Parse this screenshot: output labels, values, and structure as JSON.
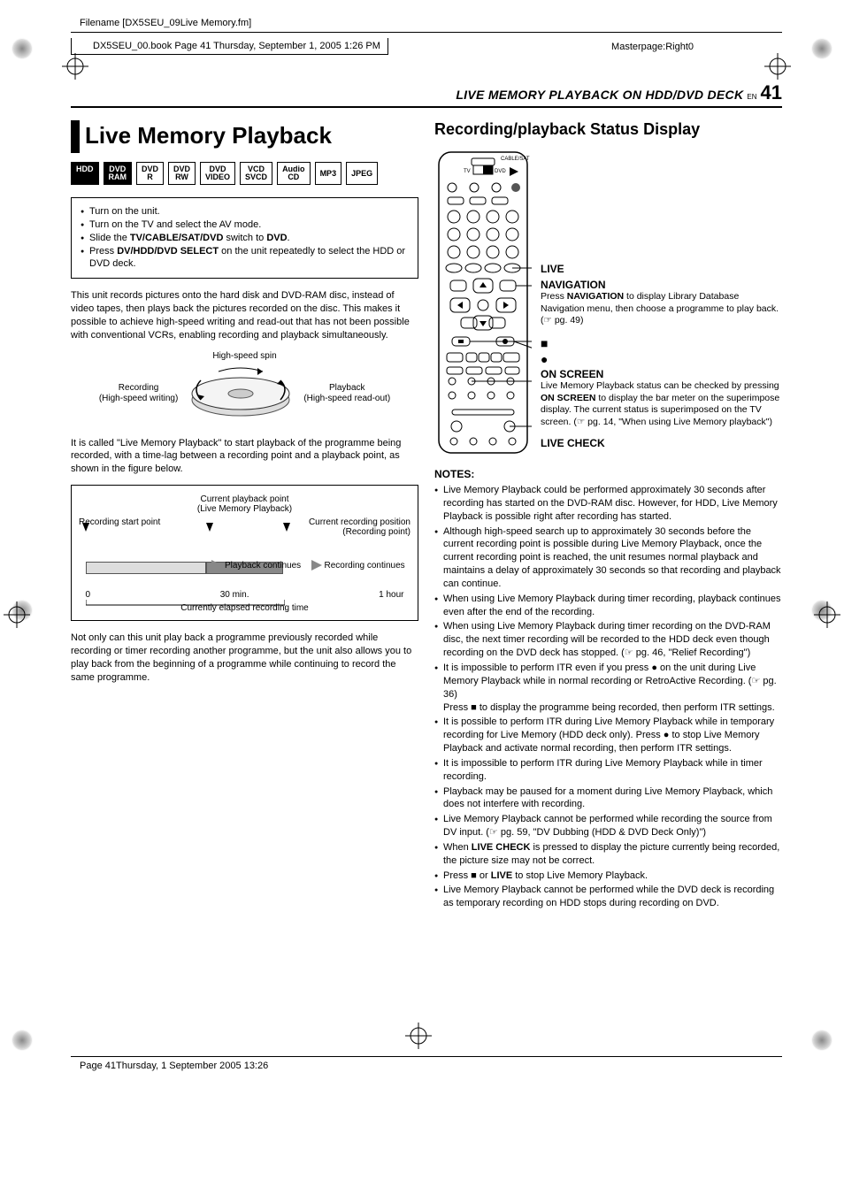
{
  "meta": {
    "filename": "Filename [DX5SEU_09Live Memory.fm]",
    "book_line": "DX5SEU_00.book  Page 41  Thursday, September 1, 2005  1:26 PM",
    "masterpage": "Masterpage:Right0",
    "footer": "Page 41Thursday, 1 September 2005  13:26"
  },
  "header": {
    "title": "LIVE MEMORY PLAYBACK ON HDD/DVD DECK",
    "lang": "EN",
    "page": "41"
  },
  "left": {
    "title": "Live Memory Playback",
    "badges_solid": [
      "HDD"
    ],
    "badges_two": [
      {
        "top": "DVD",
        "bottom": "RAM"
      }
    ],
    "badges_outline_two": [
      {
        "top": "DVD",
        "bottom": "R"
      },
      {
        "top": "DVD",
        "bottom": "RW"
      },
      {
        "top": "DVD",
        "bottom": "VIDEO"
      },
      {
        "top": "VCD",
        "bottom": "SVCD"
      },
      {
        "top": "Audio",
        "bottom": "CD"
      }
    ],
    "badges_outline_one": [
      "MP3",
      "JPEG"
    ],
    "prep": {
      "l1": "Turn on the unit.",
      "l2": "Turn on the TV and select the AV mode.",
      "l3_a": "Slide the ",
      "l3_b": "TV/CABLE/SAT/DVD",
      "l3_c": " switch to ",
      "l3_d": "DVD",
      "l3_e": ".",
      "l4_a": "Press ",
      "l4_b": "DV/HDD/DVD SELECT",
      "l4_c": " on the unit repeatedly to select the HDD or DVD deck."
    },
    "para1": "This unit records pictures onto the hard disk and DVD-RAM disc, instead of video tapes, then plays back the pictures recorded on the disc. This makes it possible to achieve high-speed writing and read-out that has not been possible with conventional VCRs, enabling recording and playback simultaneously.",
    "dia_spin": {
      "top": "High-speed spin",
      "rec1": "Recording",
      "rec2": "(High-speed writing)",
      "pb1": "Playback",
      "pb2": "(High-speed read-out)"
    },
    "para2": "It is called \"Live Memory Playback\" to start playback of the programme being recorded, with a time-lag between a recording point and a playback point, as shown in the figure below.",
    "timeline": {
      "lbl_left": "Recording start point",
      "lbl_mid_a": "Current playback point",
      "lbl_mid_b": "(Live Memory Playback)",
      "lbl_right_a": "Current recording position",
      "lbl_right_b": "(Recording point)",
      "pb_cont": "Playback continues",
      "rec_cont": "Recording continues",
      "s0": "0",
      "s30": "30 min.",
      "s60": "1 hour",
      "elapsed": "Currently elapsed recording time"
    },
    "para3": "Not only can this unit play back a programme previously recorded while recording or timer recording another programme, but the unit also allows you to play back from the beginning of a programme while continuing to record the same programme."
  },
  "right": {
    "title": "Recording/playback Status Display",
    "remote_top": "CABLE/SAT",
    "remote_tv": "TV",
    "remote_dvd": "DVD",
    "callouts": {
      "live": "LIVE",
      "nav_head": "NAVIGATION",
      "nav_a": "Press ",
      "nav_b": "NAVIGATION",
      "nav_c": " to display Library Database Navigation menu, then choose a programme to play back. (☞ pg. 49)",
      "stop": "■",
      "rec": "●",
      "os_head": "ON SCREEN",
      "os_a": "Live Memory Playback status can be checked by pressing ",
      "os_b": "ON SCREEN",
      "os_c": " to display the bar meter on the superimpose display. The current status is superimposed on the TV screen. (☞ pg. 14, \"When using Live Memory playback\")",
      "lc": "LIVE CHECK"
    },
    "notes_head": "NOTES:",
    "notes": {
      "n1": "Live Memory Playback could be performed approximately 30 seconds after recording has started on the DVD-RAM disc. However, for HDD, Live Memory Playback is possible right after recording has started.",
      "n2": "Although high-speed search up to approximately 30 seconds before the current recording point is possible during Live Memory Playback, once the current recording point is reached, the unit resumes normal playback and maintains a delay of approximately 30 seconds so that recording and playback can continue.",
      "n3": "When using Live Memory Playback during timer recording, playback continues even after the end of the recording.",
      "n4": "When using Live Memory Playback during timer recording on the DVD-RAM disc, the next timer recording will be recorded to the HDD deck even though recording on the DVD deck has stopped. (☞ pg. 46, \"Relief Recording\")",
      "n5_a": "It is impossible to perform ITR even if you press ● on the unit during Live Memory Playback while in normal recording or RetroActive Recording. (☞ pg. 36)",
      "n5_b": "Press ■ to display the programme being recorded, then perform ITR settings.",
      "n6": "It is possible to perform ITR during Live Memory Playback while in temporary recording for Live Memory (HDD deck only). Press ● to stop Live Memory Playback and activate normal recording, then perform ITR settings.",
      "n7": "It is impossible to perform ITR during Live Memory Playback while in timer recording.",
      "n8": "Playback may be paused for a moment during Live Memory Playback, which does not interfere with recording.",
      "n9": "Live Memory Playback cannot be performed while recording the source from DV input. (☞ pg. 59, \"DV Dubbing (HDD & DVD Deck Only)\")",
      "n10_a": "When ",
      "n10_b": "LIVE CHECK",
      "n10_c": " is pressed to display the picture currently being recorded, the picture size may not be correct.",
      "n11_a": "Press ■ or ",
      "n11_b": "LIVE",
      "n11_c": " to stop Live Memory Playback.",
      "n12": "Live Memory Playback cannot be performed while the DVD deck is recording as temporary recording on HDD stops during recording on DVD."
    }
  }
}
